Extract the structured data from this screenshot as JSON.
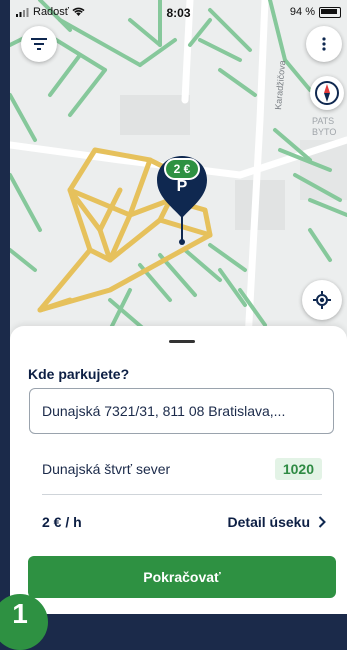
{
  "statusbar": {
    "carrier": "Radosť",
    "time": "8:03",
    "battery": "94 %"
  },
  "map": {
    "street_label": "Karadžičova",
    "area_label_1": "PATS",
    "area_label_2": "BYTO",
    "pin_price": "2 €",
    "pin_symbol": "P",
    "colors": {
      "zone_line": "#e8c15a",
      "green_line": "#7fc595",
      "pin": "#0f2850"
    }
  },
  "sheet": {
    "question": "Kde parkujete?",
    "address": "Dunajská 7321/31, 811 08 Bratislava,...",
    "zone_name": "Dunajská štvrť sever",
    "zone_code": "1020",
    "price": "2 € / h",
    "detail_label": "Detail úseku",
    "continue_label": "Pokračovať"
  },
  "step_badge": "1",
  "icons": [
    "filter-icon",
    "more-vertical-icon",
    "compass-icon",
    "locate-icon",
    "chevron-right-icon",
    "wifi-icon",
    "signal-icon",
    "battery-icon"
  ]
}
